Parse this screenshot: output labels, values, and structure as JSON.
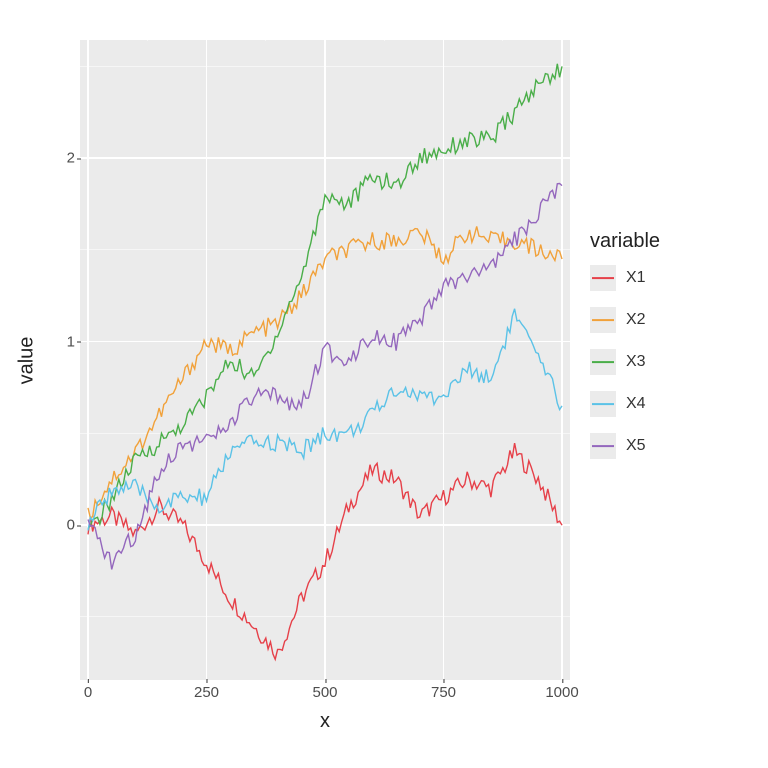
{
  "chart_data": {
    "type": "line",
    "xlabel": "x",
    "ylabel": "value",
    "legend_title": "variable",
    "xlim": [
      0,
      1000
    ],
    "ylim": [
      -0.8,
      2.6
    ],
    "x_ticks": [
      0,
      250,
      500,
      750,
      1000
    ],
    "y_ticks": [
      0,
      1,
      2
    ],
    "x": [
      0,
      50,
      100,
      150,
      200,
      250,
      300,
      350,
      400,
      450,
      500,
      550,
      600,
      650,
      700,
      750,
      800,
      850,
      900,
      950,
      1000
    ],
    "series": [
      {
        "name": "X1",
        "color": "#e64049",
        "values": [
          0.0,
          0.05,
          -0.05,
          0.1,
          0.0,
          -0.2,
          -0.4,
          -0.55,
          -0.7,
          -0.4,
          -0.2,
          0.1,
          0.3,
          0.25,
          0.05,
          0.15,
          0.25,
          0.2,
          0.4,
          0.25,
          0.0
        ]
      },
      {
        "name": "X2",
        "color": "#f1a13a",
        "values": [
          0.05,
          0.25,
          0.4,
          0.6,
          0.8,
          1.0,
          0.95,
          1.05,
          1.1,
          1.25,
          1.45,
          1.5,
          1.55,
          1.55,
          1.6,
          1.45,
          1.6,
          1.55,
          1.55,
          1.5,
          1.45
        ]
      },
      {
        "name": "X3",
        "color": "#4aae49",
        "values": [
          -0.05,
          0.15,
          0.35,
          0.45,
          0.55,
          0.7,
          0.9,
          0.8,
          1.05,
          1.35,
          1.8,
          1.75,
          1.9,
          1.85,
          2.0,
          2.05,
          2.1,
          2.1,
          2.25,
          2.4,
          2.5
        ]
      },
      {
        "name": "X4",
        "color": "#5bc2e7",
        "values": [
          0.0,
          0.2,
          0.2,
          0.1,
          0.15,
          0.15,
          0.4,
          0.45,
          0.45,
          0.4,
          0.5,
          0.5,
          0.6,
          0.75,
          0.7,
          0.7,
          0.85,
          0.8,
          1.15,
          0.9,
          0.65
        ]
      },
      {
        "name": "X5",
        "color": "#9467bd",
        "values": [
          0.0,
          -0.2,
          -0.05,
          0.3,
          0.45,
          0.45,
          0.55,
          0.7,
          0.7,
          0.65,
          0.95,
          0.9,
          1.05,
          1.0,
          1.1,
          1.3,
          1.35,
          1.4,
          1.55,
          1.7,
          1.85
        ]
      }
    ]
  }
}
